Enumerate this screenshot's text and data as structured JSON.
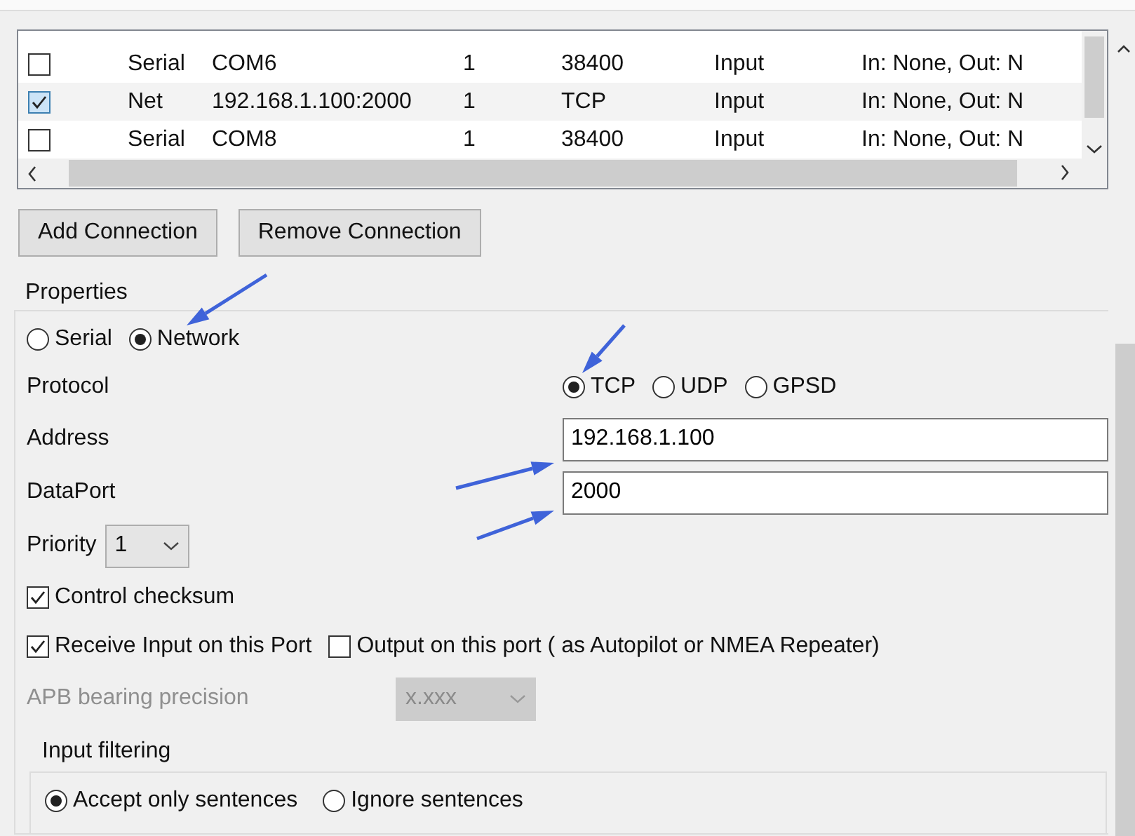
{
  "connections": {
    "rows": [
      {
        "enabled": false,
        "type": "Serial",
        "port": "COM6",
        "priority": "1",
        "protocol": "38400",
        "io": "Input",
        "filters": "In: None, Out: N"
      },
      {
        "enabled": true,
        "type": "Net",
        "port": "192.168.1.100:2000",
        "priority": "1",
        "protocol": "TCP",
        "io": "Input",
        "filters": "In: None, Out: N"
      },
      {
        "enabled": false,
        "type": "Serial",
        "port": "COM8",
        "priority": "1",
        "protocol": "38400",
        "io": "Input",
        "filters": "In: None, Out: N"
      }
    ]
  },
  "buttons": [
    "Add Connection",
    "Remove Connection"
  ],
  "properties": {
    "title": "Properties",
    "source_types": [
      {
        "label": "Serial",
        "selected": false
      },
      {
        "label": "Network",
        "selected": true
      }
    ],
    "protocol": {
      "label": "Protocol",
      "options": [
        {
          "label": "TCP",
          "selected": true
        },
        {
          "label": "UDP",
          "selected": false
        },
        {
          "label": "GPSD",
          "selected": false
        }
      ]
    },
    "address": {
      "label": "Address",
      "value": "192.168.1.100"
    },
    "data_port": {
      "label": "DataPort",
      "value": "2000"
    },
    "priority": {
      "label": "Priority",
      "value": "1"
    },
    "control_checksum": {
      "label": "Control checksum",
      "checked": true
    },
    "receive_input": {
      "label": "Receive Input on this Port",
      "checked": true
    },
    "output": {
      "label": "Output on this port ( as Autopilot or NMEA Repeater)",
      "checked": false
    },
    "apb": {
      "label": "APB bearing precision",
      "value": "x.xxx",
      "disabled": true
    },
    "input_filtering": {
      "title": "Input filtering",
      "modes": [
        {
          "label": "Accept only sentences",
          "selected": true
        },
        {
          "label": "Ignore sentences",
          "selected": false
        }
      ]
    }
  }
}
